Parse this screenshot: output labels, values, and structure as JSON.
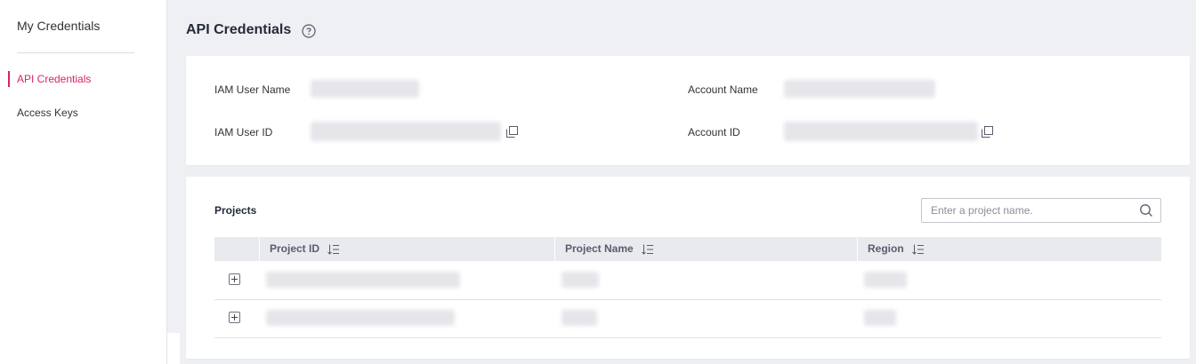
{
  "sidebar": {
    "title": "My Credentials",
    "items": [
      {
        "label": "API Credentials",
        "active": true
      },
      {
        "label": "Access Keys",
        "active": false
      }
    ]
  },
  "page": {
    "title": "API Credentials",
    "help_icon": "help-circle-icon"
  },
  "info": {
    "iam_user_name_label": "IAM User Name",
    "iam_user_id_label": "IAM User ID",
    "account_name_label": "Account Name",
    "account_id_label": "Account ID",
    "copy_icon": "copy-icon"
  },
  "projects": {
    "label": "Projects",
    "search_placeholder": "Enter a project name.",
    "search_icon": "search-icon",
    "columns": [
      "Project ID",
      "Project Name",
      "Region"
    ],
    "sort_icon": "sort-icon",
    "expand_icon": "plus-square-icon"
  },
  "colors": {
    "accent": "#d6246e",
    "page_bg": "#eff0f4",
    "table_header_bg": "#e9eaee"
  }
}
